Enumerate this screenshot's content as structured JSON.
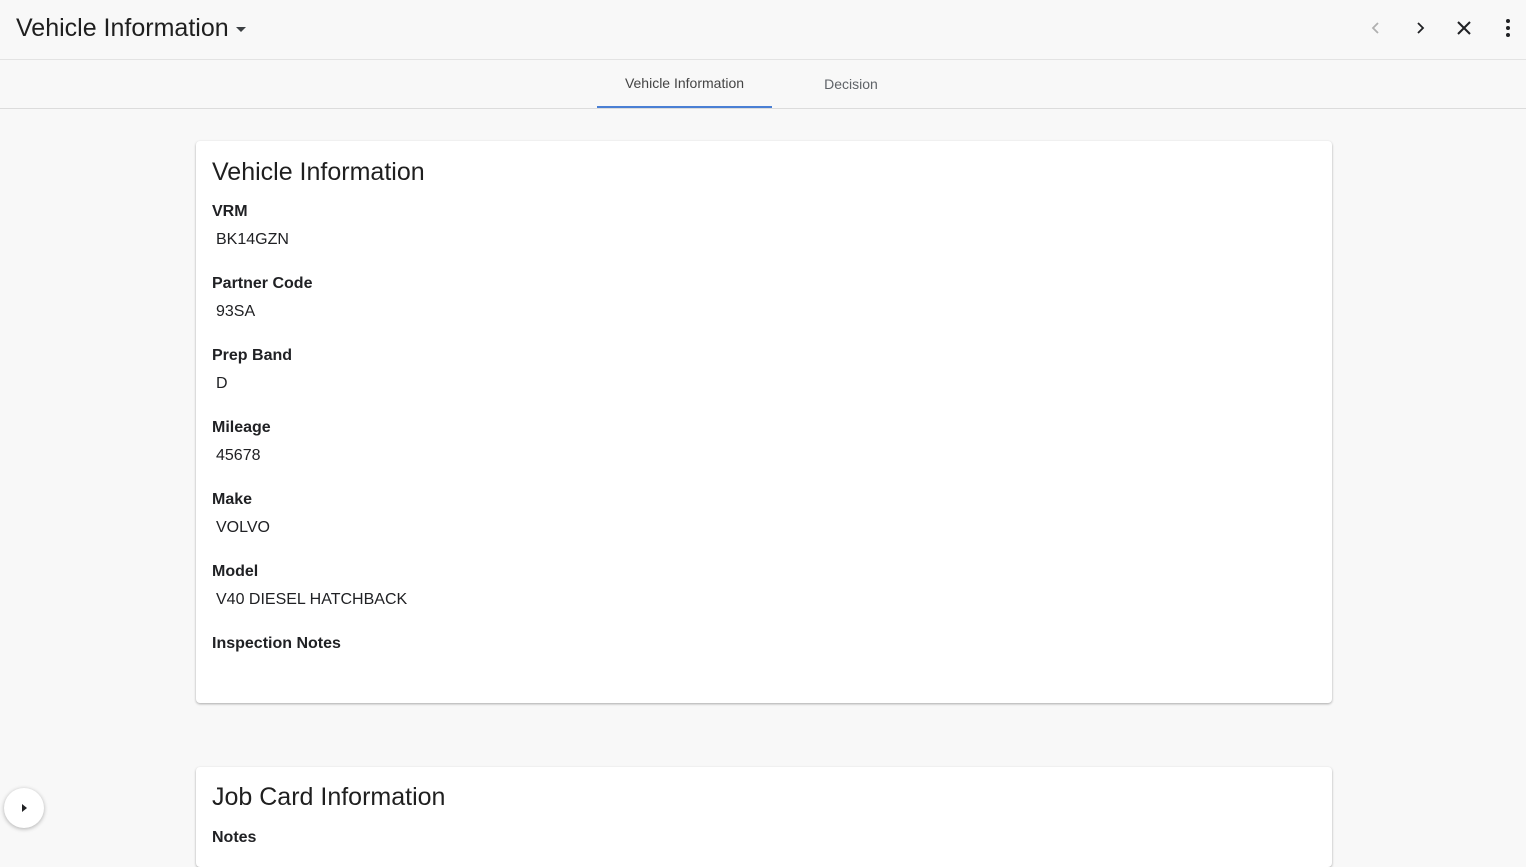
{
  "header": {
    "title": "Vehicle Information",
    "icons": [
      "caret-down-icon",
      "chevron-left-icon",
      "chevron-right-icon",
      "close-icon",
      "more-vert-icon"
    ]
  },
  "tabs": [
    {
      "label": "Vehicle Information",
      "active": true
    },
    {
      "label": "Decision",
      "active": false
    }
  ],
  "vehicle_card": {
    "title": "Vehicle Information",
    "fields": [
      {
        "label": "VRM",
        "value": "BK14GZN"
      },
      {
        "label": "Partner Code",
        "value": "93SA"
      },
      {
        "label": "Prep Band",
        "value": "D"
      },
      {
        "label": "Mileage",
        "value": "45678"
      },
      {
        "label": "Make",
        "value": "VOLVO"
      },
      {
        "label": "Model",
        "value": "V40 DIESEL HATCHBACK"
      },
      {
        "label": "Inspection Notes",
        "value": ""
      }
    ]
  },
  "job_card": {
    "title": "Job Card Information",
    "fields": [
      {
        "label": "Notes",
        "value": ""
      }
    ]
  },
  "colors": {
    "accent": "#4a7fd4",
    "background": "#f8f8f8",
    "card": "#ffffff"
  }
}
